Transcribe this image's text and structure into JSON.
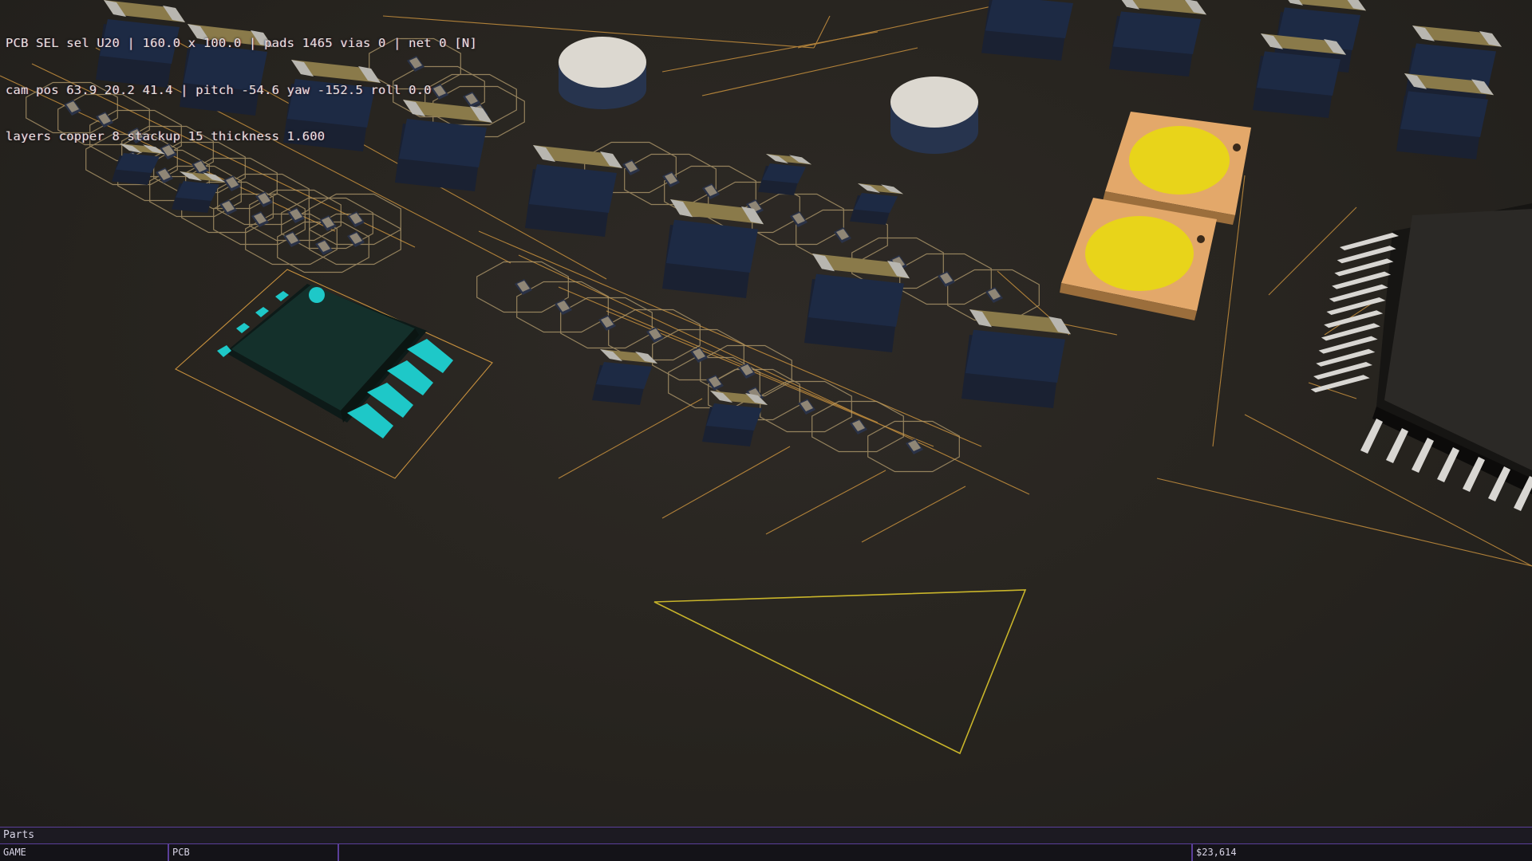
{
  "hud": {
    "line1": "PCB SEL sel U20 | 160.0 x 100.0 | pads 1465 vias 0 | net 0 [N]",
    "line2": "cam pos 63.9 20.2 41.4 | pitch -54.6 yaw -152.5 roll 0.0",
    "line3": "layers copper 8 stackup 15 thickness 1.600"
  },
  "parts_bar": {
    "label": "Parts"
  },
  "status_bar": {
    "mode": "GAME",
    "view": "PCB",
    "middle": "",
    "money": "$23,614"
  },
  "colors": {
    "board": "#27241f",
    "trace": "#c8913e",
    "keepout": "#c9b52a",
    "capacitor_body": "#1f2a40",
    "capacitor_top": "#8a7a4a",
    "ic_pin": "#1ec8c8",
    "led": "#e8d41a",
    "accent": "#5b3f9a"
  }
}
